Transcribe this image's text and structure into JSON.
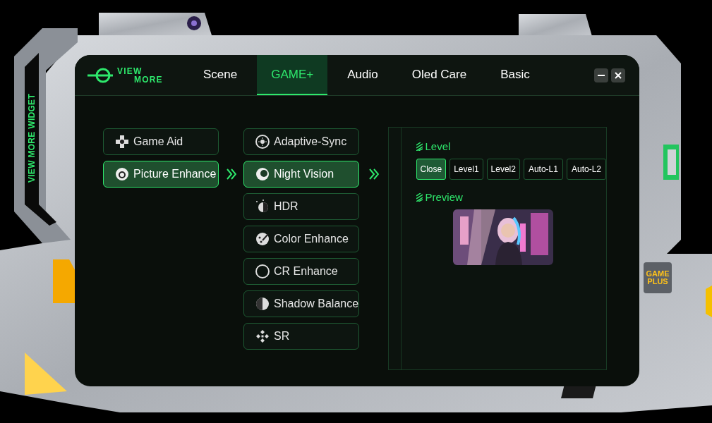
{
  "side_label": "VIEW MORE WIDGET",
  "badge": {
    "lines": [
      "GAME",
      "PLUS"
    ]
  },
  "logo": {
    "line1": "VIEW",
    "line2": "MORE"
  },
  "tabs": [
    {
      "label": "Scene",
      "selected": false
    },
    {
      "label": "GAME+",
      "selected": true
    },
    {
      "label": "Audio",
      "selected": false
    },
    {
      "label": "Oled Care",
      "selected": false
    },
    {
      "label": "Basic",
      "selected": false
    }
  ],
  "categories": [
    {
      "label": "Game Aid",
      "selected": false
    },
    {
      "label": "Picture Enhance",
      "selected": true
    }
  ],
  "features": [
    {
      "label": "Adaptive-Sync",
      "selected": false
    },
    {
      "label": "Night Vision",
      "selected": true
    },
    {
      "label": "HDR",
      "selected": false
    },
    {
      "label": "Color Enhance",
      "selected": false
    },
    {
      "label": "CR Enhance",
      "selected": false
    },
    {
      "label": "Shadow Balance",
      "selected": false
    },
    {
      "label": "SR",
      "selected": false
    }
  ],
  "level": {
    "title": "Level",
    "options": [
      {
        "label": "Close",
        "selected": true
      },
      {
        "label": "Level1",
        "selected": false
      },
      {
        "label": "Level2",
        "selected": false
      },
      {
        "label": "Auto-L1",
        "selected": false
      },
      {
        "label": "Auto-L2",
        "selected": false
      }
    ]
  },
  "preview": {
    "title": "Preview",
    "kind": "picture"
  }
}
